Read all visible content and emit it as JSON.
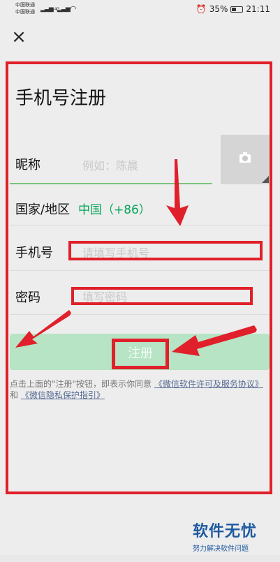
{
  "status_bar": {
    "carrier_1": "中国联通",
    "carrier_2": "中国联通",
    "signal_1": "4G",
    "signal_2": "4G",
    "battery_text": "35%",
    "time": "21:11"
  },
  "header": {
    "close_icon": "close-icon",
    "title": "手机号注册"
  },
  "form": {
    "nickname_label": "昵称",
    "nickname_placeholder": "例如：陈晨",
    "avatar_icon": "camera-icon",
    "region_label": "国家/地区",
    "region_value": "中国（+86）",
    "phone_label": "手机号",
    "phone_placeholder": "请填写手机号",
    "password_label": "密码",
    "password_placeholder": "填写密码"
  },
  "register_button": {
    "label": "注册"
  },
  "agreement": {
    "prefix": "点击上面的\"注册\"按钮，即表示你同意",
    "link_1": "《微信软件许可及服务协议》",
    "connector": "和",
    "link_2": "《微信隐私保护指引》"
  },
  "watermark": {
    "title": "软件无忧",
    "subtitle": "努力解决软件问题"
  },
  "colors": {
    "accent_green": "#07a55a",
    "button_green_disabled": "#b6e4c4",
    "link": "#576b95",
    "annotation_red": "#e0202a",
    "background": "#ededed"
  }
}
